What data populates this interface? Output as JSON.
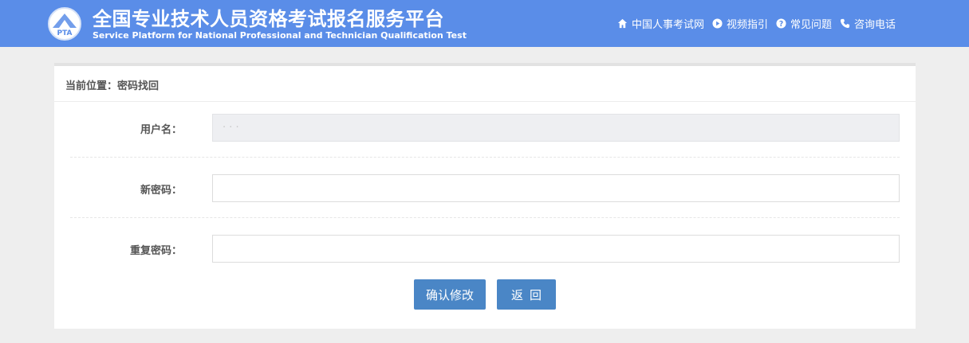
{
  "header": {
    "logo_text": "PTA",
    "title_cn": "全国专业技术人员资格考试报名服务平台",
    "title_en": "Service Platform for National Professional and Technician Qualification Test",
    "nav": [
      {
        "label": "中国人事考试网",
        "icon": "home-icon"
      },
      {
        "label": "视频指引",
        "icon": "play-icon"
      },
      {
        "label": "常见问题",
        "icon": "question-icon"
      },
      {
        "label": "咨询电话",
        "icon": "phone-icon"
      }
    ]
  },
  "breadcrumb": "当前位置：密码找回",
  "form": {
    "username_label": "用户名：",
    "username_value": "· · ·",
    "new_password_label": "新密码：",
    "new_password_value": "",
    "repeat_password_label": "重复密码：",
    "repeat_password_value": ""
  },
  "buttons": {
    "confirm": "确认修改",
    "back": "返回"
  },
  "colors": {
    "header_bg": "#5a8de8",
    "button_bg": "#4a86c6",
    "page_bg": "#eeeeee"
  }
}
